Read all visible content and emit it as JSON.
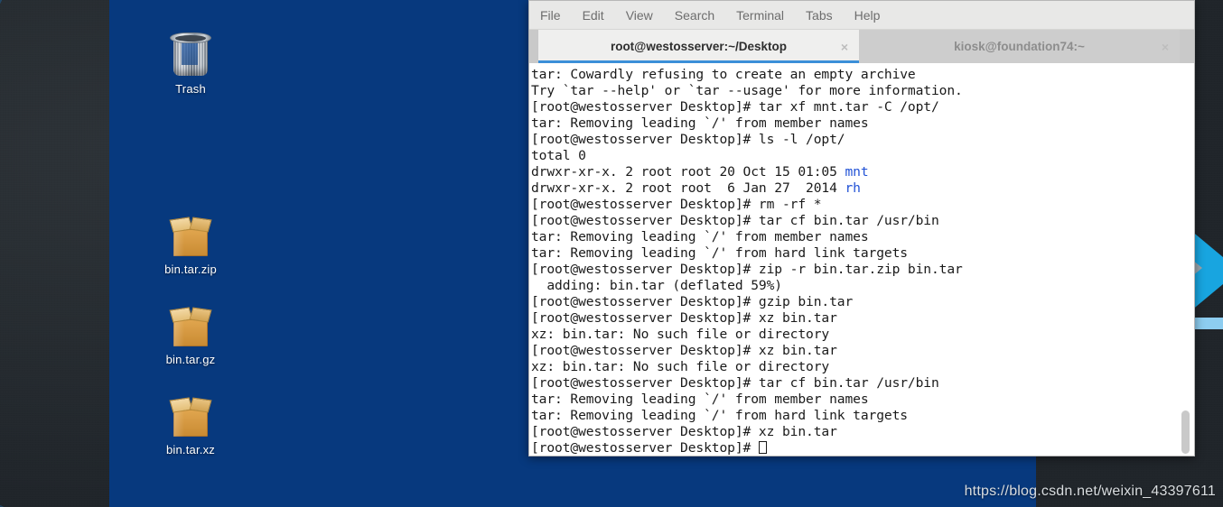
{
  "desktop": {
    "background_color": "#07397e",
    "wallpaper_color": "#272b30",
    "icons": [
      {
        "label": "Trash",
        "icon": "trash-can-icon"
      },
      {
        "label": "bin.tar.zip",
        "icon": "archive-package-icon"
      },
      {
        "label": "bin.tar.gz",
        "icon": "archive-package-icon"
      },
      {
        "label": "bin.tar.xz",
        "icon": "archive-package-icon"
      }
    ]
  },
  "terminal": {
    "menubar": [
      {
        "label": "File"
      },
      {
        "label": "Edit"
      },
      {
        "label": "View"
      },
      {
        "label": "Search"
      },
      {
        "label": "Terminal"
      },
      {
        "label": "Tabs"
      },
      {
        "label": "Help"
      }
    ],
    "tabs": [
      {
        "label": "root@westosserver:~/Desktop",
        "active": true,
        "close": "×"
      },
      {
        "label": "kiosk@foundation74:~",
        "active": false,
        "close": "×"
      }
    ],
    "accent_color": "#3b8fd8",
    "dir_color": "#2152d6",
    "prompt": "[root@westosserver Desktop]# ",
    "lines": [
      {
        "text": "tar: Cowardly refusing to create an empty archive"
      },
      {
        "text": "Try `tar --help' or `tar --usage' for more information."
      },
      {
        "text": "[root@westosserver Desktop]# tar xf mnt.tar -C /opt/"
      },
      {
        "text": "tar: Removing leading `/' from member names"
      },
      {
        "text": "[root@westosserver Desktop]# ls -l /opt/"
      },
      {
        "text": "total 0"
      },
      {
        "text": "drwxr-xr-x. 2 root root 20 Oct 15 01:05 ",
        "dir": "mnt"
      },
      {
        "text": "drwxr-xr-x. 2 root root  6 Jan 27  2014 ",
        "dir": "rh"
      },
      {
        "text": "[root@westosserver Desktop]# rm -rf *"
      },
      {
        "text": "[root@westosserver Desktop]# tar cf bin.tar /usr/bin"
      },
      {
        "text": "tar: Removing leading `/' from member names"
      },
      {
        "text": "tar: Removing leading `/' from hard link targets"
      },
      {
        "text": "[root@westosserver Desktop]# zip -r bin.tar.zip bin.tar"
      },
      {
        "text": "  adding: bin.tar (deflated 59%)"
      },
      {
        "text": "[root@westosserver Desktop]# gzip bin.tar"
      },
      {
        "text": "[root@westosserver Desktop]# xz bin.tar"
      },
      {
        "text": "xz: bin.tar: No such file or directory"
      },
      {
        "text": "[root@westosserver Desktop]# xz bin.tar"
      },
      {
        "text": "xz: bin.tar: No such file or directory"
      },
      {
        "text": "[root@westosserver Desktop]# tar cf bin.tar /usr/bin"
      },
      {
        "text": "tar: Removing leading `/' from member names"
      },
      {
        "text": "tar: Removing leading `/' from hard link targets"
      },
      {
        "text": "[root@westosserver Desktop]# xz bin.tar"
      },
      {
        "text": "[root@westosserver Desktop]# ",
        "cursor": true
      }
    ]
  },
  "watermark": {
    "text": "https://blog.csdn.net/weixin_43397611"
  }
}
